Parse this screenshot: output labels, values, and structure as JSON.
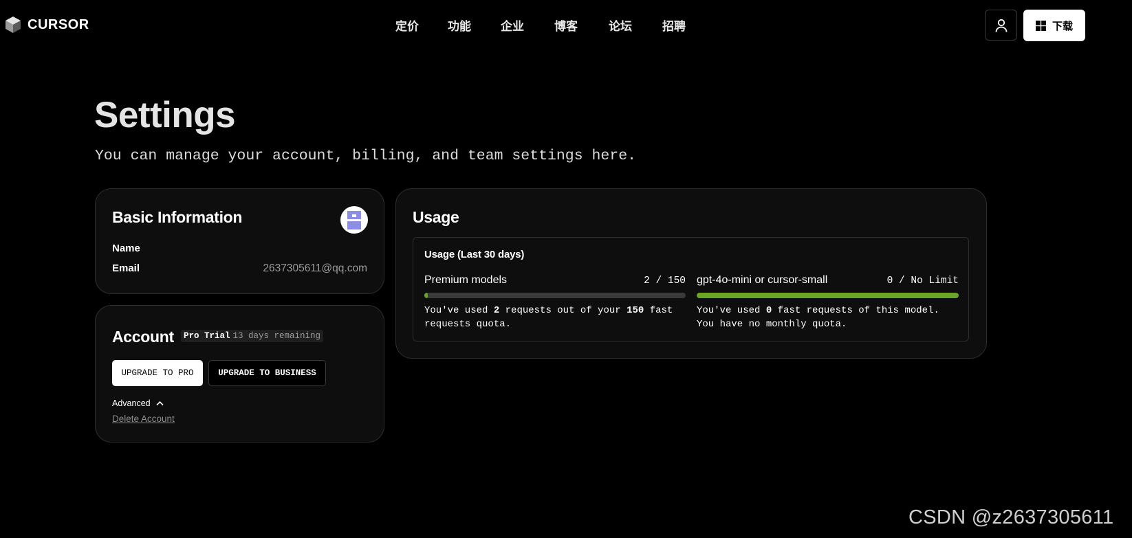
{
  "header": {
    "logo_text": "CURSOR",
    "nav": [
      "定价",
      "功能",
      "企业",
      "博客",
      "论坛",
      "招聘"
    ],
    "download_label": "下载"
  },
  "page": {
    "title": "Settings",
    "subtitle": "You can manage your account, billing, and team settings here."
  },
  "basic_info": {
    "title": "Basic Information",
    "name_label": "Name",
    "email_label": "Email",
    "email_value": "2637305611@qq.com"
  },
  "account": {
    "title": "Account",
    "plan": "Pro Trial",
    "days_remaining": "13 days remaining",
    "upgrade_pro": "UPGRADE TO PRO",
    "upgrade_business": "UPGRADE TO BUSINESS",
    "advanced_label": "Advanced",
    "delete_label": "Delete Account"
  },
  "usage": {
    "title": "Usage",
    "period_label": "Usage (Last 30 days)",
    "models": [
      {
        "name": "Premium models",
        "count": "2 / 150",
        "fraction": 0.0133,
        "desc_1": "You've used ",
        "desc_num": "2",
        "desc_2": " requests out of your ",
        "desc_num2": "150",
        "desc_3": " fast requests quota."
      },
      {
        "name": "gpt-4o-mini or cursor-small",
        "count": "0 / No Limit",
        "fraction": 1,
        "desc_1": "You've used ",
        "desc_num": "0",
        "desc_2": " fast requests of this model. You have no monthly quota."
      }
    ],
    "bar_color": "#6aa527"
  },
  "watermark": "CSDN @z2637305611"
}
